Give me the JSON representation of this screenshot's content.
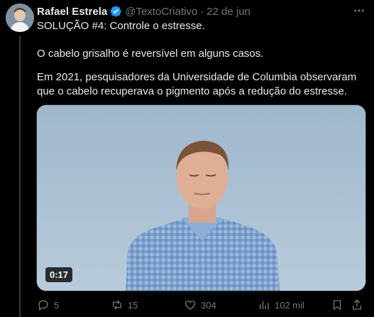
{
  "author": {
    "name": "Rafael Estrela",
    "handle": "@TextoCriativo",
    "separator": "·",
    "date": "22 de jun"
  },
  "post": {
    "line1": "SOLUÇÃO #4: Controle o estresse.",
    "line2": "O cabelo grisalho é reversível em alguns casos.",
    "line3": "Em 2021, pesquisadores da Universidade de Columbia observaram que o cabelo recuperava o pigmento após a redução do estresse."
  },
  "video": {
    "duration": "0:17"
  },
  "actions": {
    "replies": "5",
    "reposts": "15",
    "likes": "304",
    "views": "102 mil"
  },
  "colors": {
    "background": "#000000",
    "text": "#e7e9ea",
    "secondary": "#71767b",
    "verified": "#1d9bf0"
  },
  "icons": [
    "more-icon",
    "verified-icon",
    "reply-icon",
    "repost-icon",
    "like-icon",
    "views-icon",
    "bookmark-icon",
    "share-icon"
  ]
}
